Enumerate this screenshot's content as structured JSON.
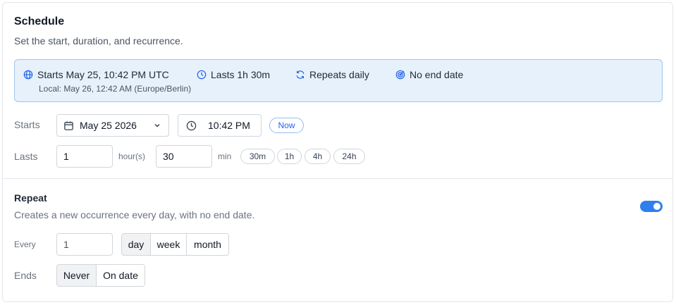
{
  "header": {
    "title": "Schedule",
    "subtitle": "Set the start, duration, and recurrence."
  },
  "summary": {
    "starts": "Starts May 25, 10:42 PM UTC",
    "local": "Local: May 26, 12:42 AM (Europe/Berlin)",
    "lasts": "Lasts 1h 30m",
    "repeats": "Repeats daily",
    "ends": "No end date",
    "icons": [
      "globe-icon",
      "clock-icon",
      "refresh-icon",
      "target-icon"
    ]
  },
  "starts": {
    "label": "Starts",
    "date": "May 25 2026",
    "time": "10:42 PM",
    "now_label": "Now"
  },
  "lasts": {
    "label": "Lasts",
    "hours": "1",
    "hours_unit": "hour(s)",
    "minutes": "30",
    "minutes_unit": "min",
    "presets": [
      "30m",
      "1h",
      "4h",
      "24h"
    ]
  },
  "repeat": {
    "title": "Repeat",
    "description": "Creates a new occurrence every day, with no end date.",
    "enabled": true,
    "every_label": "Every",
    "every_value": "1",
    "units": [
      "day",
      "week",
      "month"
    ],
    "selected_unit": "day",
    "ends_label": "Ends",
    "ends_options": [
      "Never",
      "On date"
    ],
    "selected_end": "Never"
  },
  "colors": {
    "accent": "#2f80ed",
    "summary_bg": "#e6f1fb",
    "summary_border": "#9cc7ef"
  }
}
